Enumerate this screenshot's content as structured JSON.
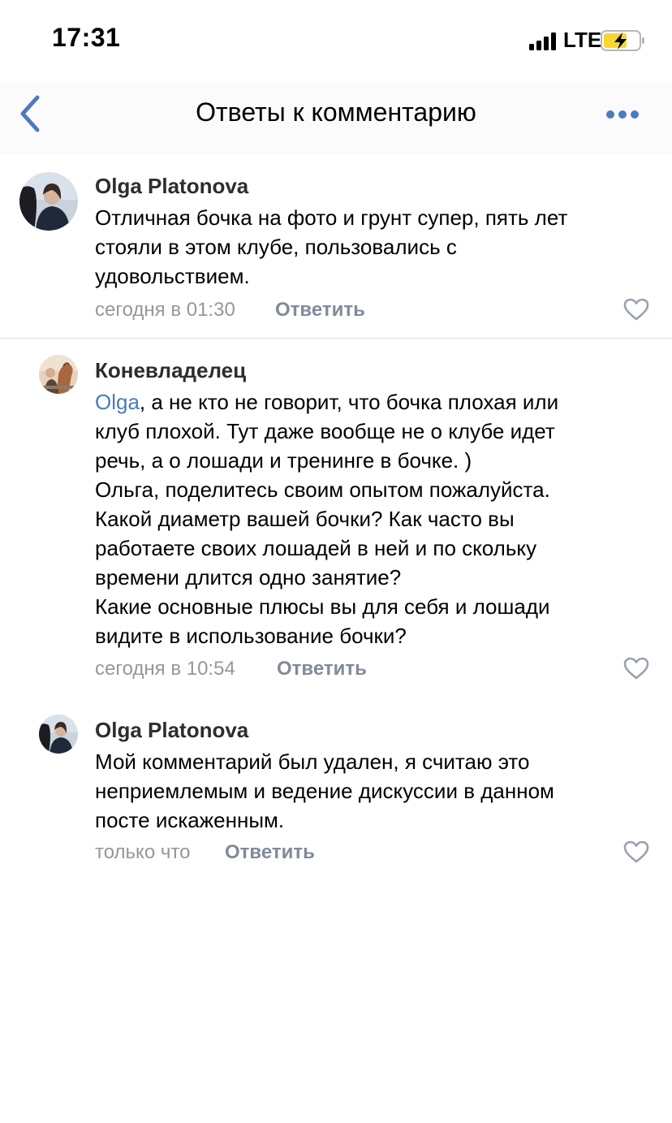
{
  "status_bar": {
    "time": "17:31",
    "network": "LTE",
    "signal_icon": "signal-bars-icon",
    "battery_icon": "battery-charging-icon"
  },
  "nav": {
    "back_icon": "chevron-left-icon",
    "title": "Ответы к комментарию",
    "more_icon": "more-dots-icon"
  },
  "colors": {
    "accent": "#4b7bbf",
    "meta": "#959799",
    "action": "#828a99",
    "battery_fill": "#f7d634"
  },
  "comments": [
    {
      "author": "Olga Platonova",
      "avatar_icon": "avatar-photo",
      "lines": [
        "Отличная бочка на фото и грунт супер, пять лет",
        "стояли в этом клубе, пользовались с",
        "удовольствием."
      ],
      "time": "сегодня в 01:30",
      "reply_label": "Ответить",
      "like_icon": "heart-outline-icon"
    },
    {
      "author": "Коневладелец",
      "avatar_icon": "avatar-photo",
      "mention": "Olga",
      "lines": [
        ", а не кто не говорит, что бочка плохая или",
        "клуб плохой. Тут даже вообще не о клубе идет",
        "речь, а о лошади и тренинге в бочке. )",
        "Ольга, поделитесь своим опытом пожалуйста.",
        "Какой диаметр вашей бочки? Как часто вы",
        "работаете своих лошадей в ней и по скольку",
        "времени длится одно занятие?",
        "Какие основные плюсы вы для себя и лошади",
        "видите в использование бочки?"
      ],
      "time": "сегодня в 10:54",
      "reply_label": "Ответить",
      "like_icon": "heart-outline-icon"
    },
    {
      "author": "Olga Platonova",
      "avatar_icon": "avatar-photo",
      "lines": [
        "Мой комментарий был удален, я считаю это",
        "неприемлемым и ведение дискуссии в данном",
        "посте искаженным."
      ],
      "time": "только что",
      "reply_label": "Ответить",
      "like_icon": "heart-outline-icon"
    }
  ]
}
